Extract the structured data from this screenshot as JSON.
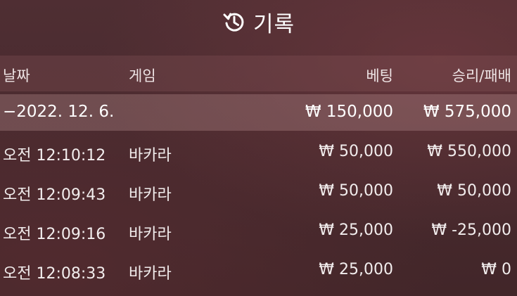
{
  "title": "기록",
  "icons": {
    "title": "history-icon"
  },
  "colors": {
    "background": "#4a2b30",
    "text": "#f1ecec",
    "header_band": "#5d3c40",
    "summary_band": "#7e5f62"
  },
  "columns": {
    "date": "날짜",
    "game": "게임",
    "bet": "베팅",
    "result": "승리/패배"
  },
  "summary": {
    "date": "−2022. 12. 6.",
    "bet": "₩ 150,000",
    "result": "₩ 575,000"
  },
  "rows": [
    {
      "time": "오전 12:10:12",
      "game": "바카라",
      "bet": "₩ 50,000",
      "result": "₩ 550,000"
    },
    {
      "time": "오전 12:09:43",
      "game": "바카라",
      "bet": "₩ 50,000",
      "result": "₩ 50,000"
    },
    {
      "time": "오전 12:09:16",
      "game": "바카라",
      "bet": "₩ 25,000",
      "result": "₩ -25,000"
    },
    {
      "time": "오전 12:08:33",
      "game": "바카라",
      "bet": "₩ 25,000",
      "result": "₩ 0"
    }
  ]
}
